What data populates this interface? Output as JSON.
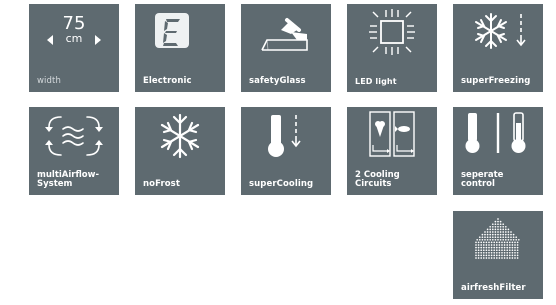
{
  "features": [
    {
      "id": "width",
      "label": "width",
      "value": "75",
      "unit": "cm",
      "icon": "width-arrows-icon"
    },
    {
      "id": "electronic",
      "label": "Electronic",
      "icon": "digital-display-icon"
    },
    {
      "id": "safety-glass",
      "label": "safetyGlass",
      "icon": "glass-shelf-icon"
    },
    {
      "id": "led-light",
      "label": "LED light",
      "icon": "led-light-icon"
    },
    {
      "id": "super-freezing",
      "label": "superFreezing",
      "icon": "snowflake-down-arrow-icon"
    },
    {
      "id": "multi-airflow",
      "label_line1": "multiAirflow-",
      "label_line2": "System",
      "icon": "airflow-icon"
    },
    {
      "id": "no-frost",
      "label": "noFrost",
      "icon": "snowflake-icon"
    },
    {
      "id": "super-cooling",
      "label": "superCooling",
      "icon": "thermometer-down-arrow-icon"
    },
    {
      "id": "cooling-circuits",
      "label_line1": "2 Cooling",
      "label_line2": "Circuits",
      "icon": "two-cooling-circuits-icon"
    },
    {
      "id": "separate-control",
      "label_line1": "seperate",
      "label_line2": "control",
      "icon": "two-thermometers-icon"
    },
    {
      "id": "airfresh-filter",
      "label": "airfreshFilter",
      "icon": "dotted-house-filter-icon"
    }
  ],
  "colors": {
    "tile_bg": "#5e6a70",
    "icon_fg": "#ffffff",
    "label_dim": "#d4d9dc",
    "page_bg": "#ffffff"
  }
}
